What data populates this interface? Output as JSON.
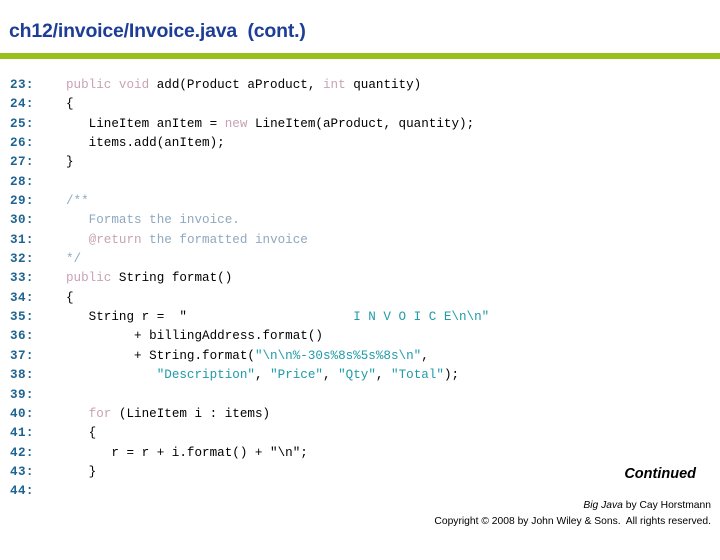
{
  "header": {
    "title": "ch12/invoice/Invoice.java  (cont.)",
    "title_color": "#1d3d96",
    "rule_color": "#9ac01c"
  },
  "code": {
    "language": "java",
    "first_line_number": 23,
    "last_line_number": 44,
    "colors": {
      "line_number": "#1f6491",
      "keyword": "#c8a2b4",
      "comment": "#8fa8c0",
      "string": "#1f9ba8",
      "plain": "#000000"
    },
    "lines": [
      {
        "no": "23:",
        "text": "public void add(Product aProduct, int quantity)"
      },
      {
        "no": "24:",
        "text": "{"
      },
      {
        "no": "25:",
        "text": "   LineItem anItem = new LineItem(aProduct, quantity);"
      },
      {
        "no": "26:",
        "text": "   items.add(anItem);"
      },
      {
        "no": "27:",
        "text": "}"
      },
      {
        "no": "28:",
        "text": ""
      },
      {
        "no": "29:",
        "text": "/**"
      },
      {
        "no": "30:",
        "text": "   Formats the invoice."
      },
      {
        "no": "31:",
        "text": "   @return the formatted invoice"
      },
      {
        "no": "32:",
        "text": "*/"
      },
      {
        "no": "33:",
        "text": "public String format()"
      },
      {
        "no": "34:",
        "text": "{"
      },
      {
        "no": "35:",
        "text": "   String r = \"                       I N V O I C E\\n\\n\""
      },
      {
        "no": "36:",
        "text": "         + billingAddress.format()"
      },
      {
        "no": "37:",
        "text": "         + String.format(\"\\n\\n%-30s%8s%5s%8s\\n\","
      },
      {
        "no": "38:",
        "text": "            \"Description\", \"Price\", \"Qty\", \"Total\");"
      },
      {
        "no": "39:",
        "text": ""
      },
      {
        "no": "40:",
        "text": "   for (LineItem i : items)"
      },
      {
        "no": "41:",
        "text": "   {"
      },
      {
        "no": "42:",
        "text": "      r = r + i.format() + \"\\n\";"
      },
      {
        "no": "43:",
        "text": "   }"
      },
      {
        "no": "44:",
        "text": ""
      }
    ]
  },
  "footer": {
    "continued_label": "Continued",
    "credit_book": "Big Java",
    "credit_rest": " by Cay Horstmann",
    "copyright": "Copyright © 2008 by John Wiley & Sons.  All rights reserved."
  }
}
